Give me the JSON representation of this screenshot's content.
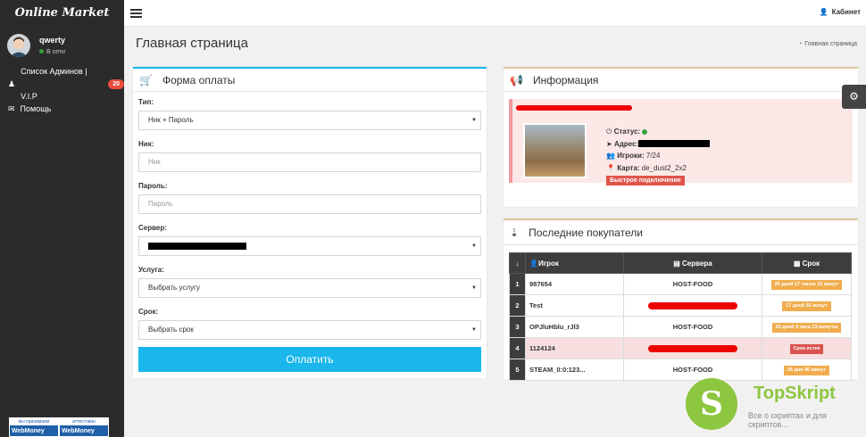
{
  "sidebar": {
    "logo": "Online Market",
    "user": {
      "name": "qwerty",
      "status": "В сети"
    },
    "items": [
      {
        "label": "Список Админов | V.I.P",
        "badge": "20"
      },
      {
        "label": "Помощь"
      }
    ],
    "webmoney": [
      {
        "top": "мы принимаем",
        "bottom": "WebMoney"
      },
      {
        "top": "аттестован",
        "bottom": "WebMoney"
      }
    ]
  },
  "topbar": {
    "cabinet_label": "Кабинет"
  },
  "page": {
    "title": "Главная страница",
    "breadcrumb": "Главная страница"
  },
  "payment_form": {
    "title": "Форма оплаты",
    "type_label": "Тип:",
    "type_value": "Ник + Пароль",
    "nick_label": "Ник:",
    "nick_placeholder": "Ник",
    "password_label": "Пароль:",
    "password_placeholder": "Пароль",
    "server_label": "Сервер:",
    "service_label": "Услуга:",
    "service_value": "Выбрать услугу",
    "term_label": "Срок:",
    "term_value": "Выбрать срок",
    "pay_button": "Оплатить"
  },
  "info": {
    "title": "Информация",
    "status_label": "Статус:",
    "address_label": "Адрес:",
    "players_label": "Игроки:",
    "players_value": "7/24",
    "map_label": "Карта:",
    "map_value": "de_dust2_2x2",
    "quick_connect": "Быстрое подключение"
  },
  "buyers": {
    "title": "Последние покупатели",
    "columns": [
      "Игрок",
      "Сервера",
      "Срок"
    ],
    "rows": [
      {
        "n": "1",
        "player": "987654",
        "server": "HOST-FOOD",
        "term": "26 дней 17 часов 15 минут"
      },
      {
        "n": "2",
        "player": "Test",
        "server": "",
        "term": "17 дней 55 минут"
      },
      {
        "n": "3",
        "player": "OPJluHblu_rJl3",
        "server": "HOST-FOOD",
        "term": "25 дней 3 часа 23 минуты"
      },
      {
        "n": "4",
        "player": "1124124",
        "server": "",
        "term": "Срок истек"
      },
      {
        "n": "5",
        "player": "STEAM_0:0:123...",
        "server": "HOST-FOOD",
        "term": "26 дня 46 минут"
      }
    ]
  },
  "watermark": {
    "name": "TopSkript",
    "letter": "S",
    "sub": "Все о скриптах и для скриптов..."
  },
  "colors": {
    "accent": "#19b7ec",
    "sidebar": "#2b2b2b",
    "badge": "#e74c3c",
    "term": "#f0ad4e",
    "expired": "#d9534f",
    "info_accent": "#e2c69c"
  }
}
